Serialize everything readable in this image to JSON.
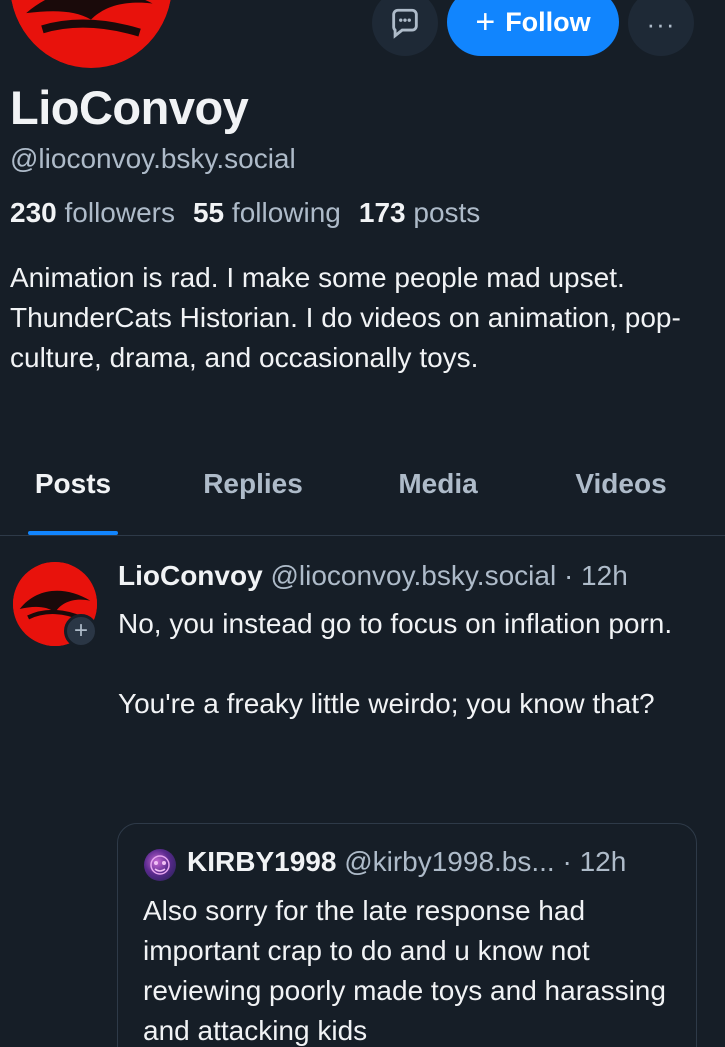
{
  "profile": {
    "display_name": "LioConvoy",
    "handle": "@lioconvoy.bsky.social",
    "follow_label": "Follow",
    "followers_count": "230",
    "followers_label": "followers",
    "following_count": "55",
    "following_label": "following",
    "posts_count": "173",
    "posts_label": "posts",
    "bio": "Animation is rad. I make some people mad upset. ThunderCats Historian. I do videos on animation, pop-culture, drama, and occasionally toys."
  },
  "tabs": [
    {
      "label": "Posts",
      "active": true
    },
    {
      "label": "Replies",
      "active": false
    },
    {
      "label": "Media",
      "active": false
    },
    {
      "label": "Videos",
      "active": false
    }
  ],
  "post": {
    "author": "LioConvoy",
    "handle": "@lioconvoy.bsky.social",
    "time": "· 12h",
    "paragraphs": [
      "No, you instead go to focus on inflation porn.",
      "You're a freaky little weirdo; you know that?"
    ],
    "quote": {
      "author": "KIRBY1998",
      "handle": "@kirby1998.bs...",
      "time": "· 12h",
      "text": "Also sorry for the late response had important crap to do and u know not reviewing poorly made toys and harassing and attacking kids"
    }
  },
  "colors": {
    "background": "#161e27",
    "accent": "#1185fe",
    "text_primary": "#f1f3f5",
    "text_secondary": "#aebbc9",
    "avatar_red": "#e8120c"
  },
  "icons": {
    "message": "message-bubble-icon",
    "more": "ellipsis-icon",
    "plus": "plus-icon"
  }
}
